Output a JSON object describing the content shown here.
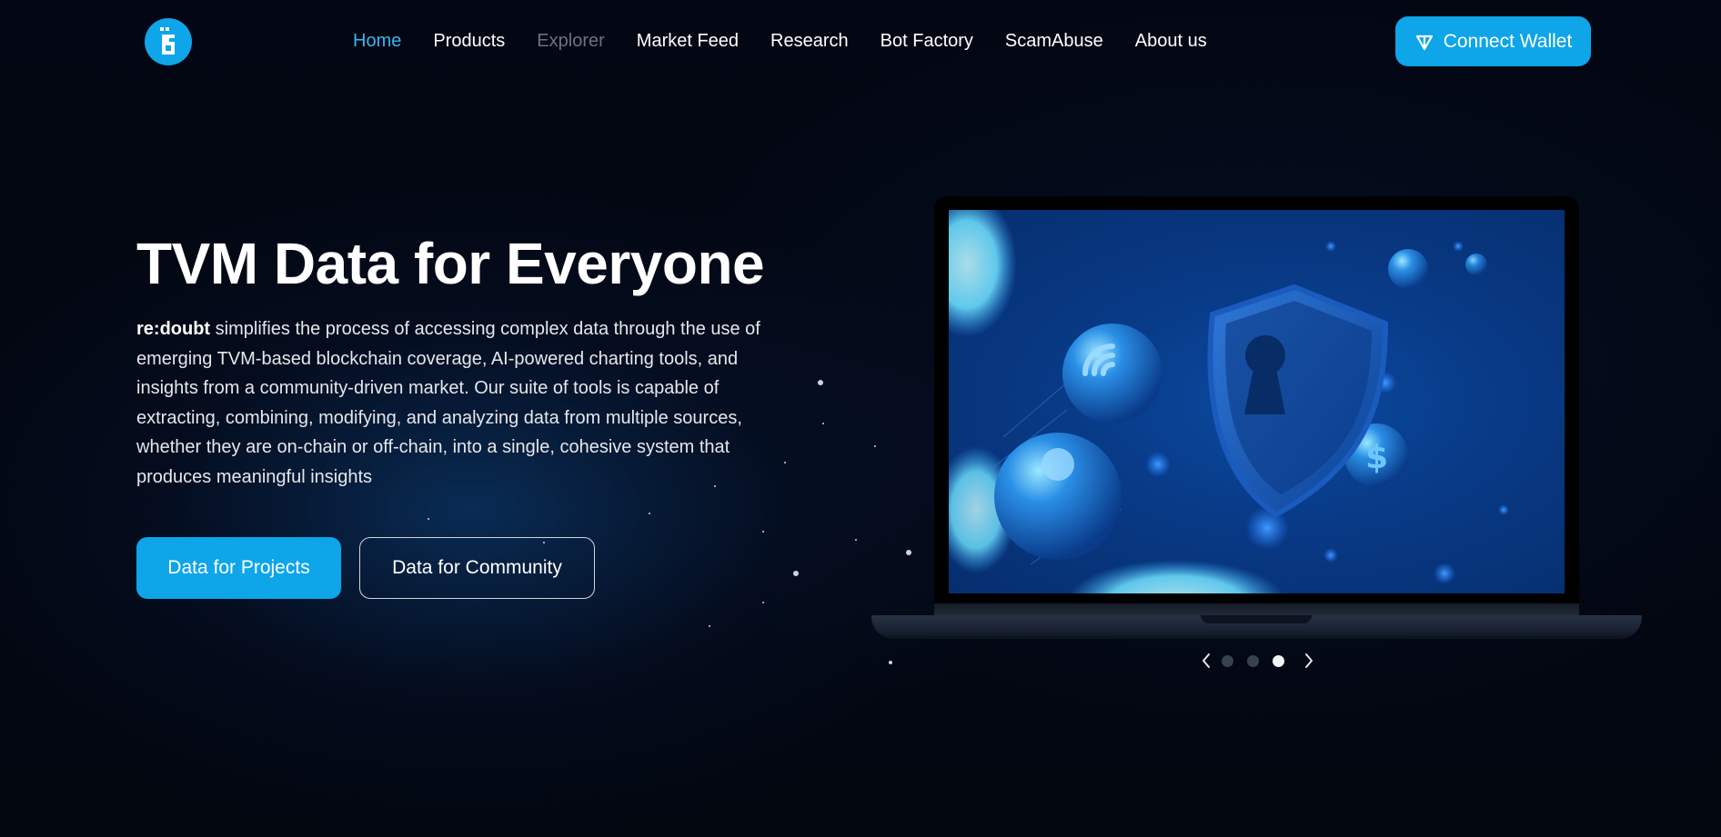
{
  "header": {
    "logo_name": "redoubt-logo",
    "nav": [
      {
        "label": "Home",
        "state": "active"
      },
      {
        "label": "Products",
        "state": "normal"
      },
      {
        "label": "Explorer",
        "state": "disabled"
      },
      {
        "label": "Market Feed",
        "state": "normal"
      },
      {
        "label": "Research",
        "state": "normal"
      },
      {
        "label": "Bot Factory",
        "state": "normal"
      },
      {
        "label": "ScamAbuse",
        "state": "normal"
      },
      {
        "label": "About us",
        "state": "normal"
      }
    ],
    "connect_wallet_label": "Connect Wallet",
    "connect_wallet_icon": "ton-icon"
  },
  "hero": {
    "title": "TVM Data for Everyone",
    "brand": "re:doubt",
    "description": " simplifies the process of accessing complex data through the use of emerging TVM-based blockchain coverage, AI-powered charting tools, and insights from a community-driven market. Our suite of tools is capable of extracting, combining, modifying, and analyzing data from multiple sources, whether they are on-chain or off-chain, into a single, cohesive system that produces meaningful insights",
    "primary_button": "Data for Projects",
    "secondary_button": "Data for Community"
  },
  "carousel": {
    "slide_count": 3,
    "active_slide": 3,
    "prev_icon": "chevron-left-icon",
    "next_icon": "chevron-right-icon"
  },
  "colors": {
    "accent": "#0ea5e9",
    "nav_active": "#38b6f0",
    "nav_disabled": "#6b7280",
    "background": "#02060f"
  }
}
